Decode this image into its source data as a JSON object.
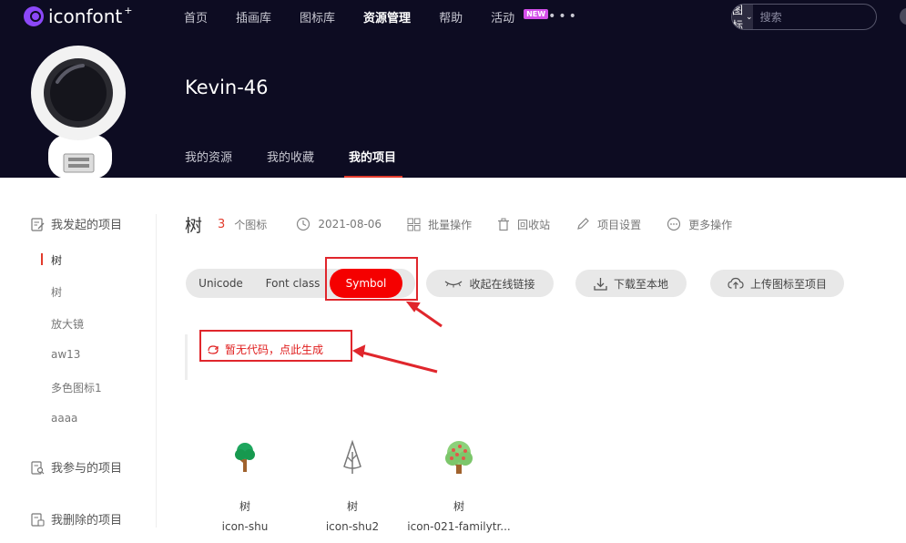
{
  "brand": {
    "name": "iconfont",
    "star": "+"
  },
  "nav": {
    "items": [
      {
        "label": "首页",
        "active": false
      },
      {
        "label": "插画库",
        "active": false
      },
      {
        "label": "图标库",
        "active": false
      },
      {
        "label": "资源管理",
        "active": true
      },
      {
        "label": "帮助",
        "active": false
      },
      {
        "label": "活动",
        "active": false,
        "badge": "NEW"
      }
    ],
    "more": "•••"
  },
  "search": {
    "type": "图标",
    "placeholder": "搜索"
  },
  "profile": {
    "username": "Kevin-46",
    "tabs": [
      {
        "label": "我的资源",
        "active": false
      },
      {
        "label": "我的收藏",
        "active": false
      },
      {
        "label": "我的项目",
        "active": true
      }
    ]
  },
  "sidebar": {
    "group_initiated": "我发起的项目",
    "projects": [
      {
        "label": "树",
        "active": true
      },
      {
        "label": "树",
        "active": false
      },
      {
        "label": "放大镜",
        "active": false
      },
      {
        "label": "aw13",
        "active": false
      },
      {
        "label": "多色图标1",
        "active": false
      },
      {
        "label": "aaaa",
        "active": false
      }
    ],
    "group_joined": "我参与的项目",
    "group_deleted": "我删除的项目"
  },
  "project": {
    "title": "树",
    "count": "3",
    "count_label": "个图标",
    "date": "2021-08-06",
    "batch": "批量操作",
    "trash": "回收站",
    "settings": "项目设置",
    "more_ops": "更多操作"
  },
  "toolbar": {
    "modes": [
      "Unicode",
      "Font class",
      "Symbol"
    ],
    "active_mode": "Symbol",
    "collapse": "收起在线链接",
    "download": "下载至本地",
    "upload": "上传图标至项目"
  },
  "code": {
    "generate": "暂无代码，点此生成"
  },
  "icons": [
    {
      "name": "树",
      "code": "icon-shu"
    },
    {
      "name": "树",
      "code": "icon-shu2"
    },
    {
      "name": "树",
      "code": "icon-021-familytr..."
    }
  ],
  "colors": {
    "accent": "#f50000",
    "annotation": "#e0262c",
    "dark": "#0d0c22",
    "badge": "#d44eea"
  }
}
